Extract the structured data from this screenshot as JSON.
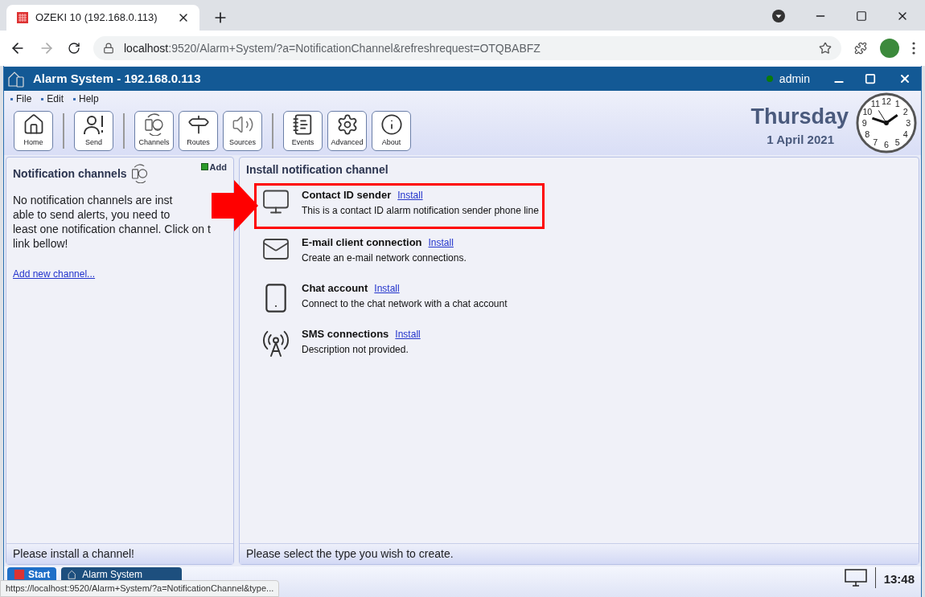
{
  "browser": {
    "tab_title": "OZEKI 10 (192.168.0.113)",
    "url_host": "localhost",
    "url_rest": ":9520/Alarm+System/?a=NotificationChannel&refreshrequest=OTQBABFZ",
    "status_url": "https://localhost:9520/Alarm+System/?a=NotificationChannel&type..."
  },
  "app": {
    "title": "Alarm System - 192.168.0.113",
    "user": "admin",
    "menu": [
      "File",
      "Edit",
      "Help"
    ]
  },
  "toolbar_groups": [
    [
      {
        "kind": "home",
        "label": "Home"
      }
    ],
    [
      {
        "kind": "send",
        "label": "Send"
      }
    ],
    [
      {
        "kind": "channels",
        "label": "Channels"
      },
      {
        "kind": "routes",
        "label": "Routes"
      },
      {
        "kind": "sources",
        "label": "Sources"
      }
    ],
    [
      {
        "kind": "events",
        "label": "Events"
      },
      {
        "kind": "advanced",
        "label": "Advanced"
      },
      {
        "kind": "about",
        "label": "About"
      }
    ]
  ],
  "date": {
    "day": "Thursday",
    "date": "1 April 2021",
    "clock_numerals": [
      "11",
      "12",
      "1",
      "10",
      "2",
      "9",
      "3",
      "8",
      "4",
      "7",
      "6",
      "5"
    ]
  },
  "left_panel": {
    "title": "Notification channels",
    "add": "Add",
    "text_lines": [
      "No notification channels are inst",
      "able to send alerts, you need to",
      "least one notification channel. Click on t",
      "link bellow!"
    ],
    "link": "Add new channel...",
    "footer": "Please install a channel!"
  },
  "right_panel": {
    "title": "Install notification channel",
    "items": [
      {
        "kind": "computer",
        "title": "Contact ID sender",
        "link": "Install",
        "description": "This is a contact ID alarm notification sender phone line",
        "highlighted": true
      },
      {
        "kind": "mail",
        "title": "E-mail client connection",
        "link": "Install",
        "description": "Create an e-mail network connections.",
        "highlighted": false
      },
      {
        "kind": "chat",
        "title": "Chat account",
        "link": "Install",
        "description": "Connect to the chat network with a chat account",
        "highlighted": false
      },
      {
        "kind": "sms",
        "title": "SMS connections",
        "link": "Install",
        "description": "Description not provided.",
        "highlighted": false
      }
    ],
    "footer": "Please select the type you wish to create."
  },
  "taskbar": {
    "start": "Start",
    "task": "Alarm System",
    "time": "13:48"
  }
}
